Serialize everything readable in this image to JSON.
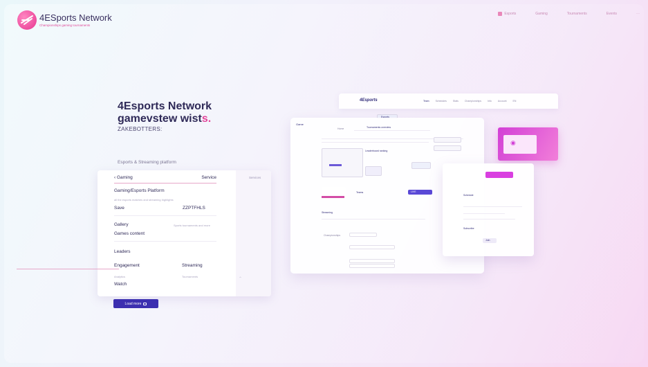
{
  "header": {
    "brand": "4ESports Network",
    "tagline": "Championships gaming tournaments",
    "nav": [
      "Esports",
      "Gaming",
      "Tournaments",
      "Events"
    ]
  },
  "hero": {
    "title_line1": "4Esports Network",
    "title_line2a": "gamevstew wist",
    "title_line2b": "s.",
    "subtitle": "ZAKEBOTTERS:",
    "platform_caption": "Esports & Streaming platform"
  },
  "card": {
    "tab_left": "Gaming",
    "tab_right": "Service",
    "tab_extra": "Services",
    "heading": "Gaming/Esports Platform",
    "desc": "all the esports matches and streaming highlights",
    "row1_left": "Save",
    "row1_right": "ZZPTFHLS",
    "row2_left": "Gallery",
    "row2_right": "Sports tournaments and more",
    "row3": "Games content",
    "row4": "Leaders",
    "row5_left": "Engagement",
    "row5_right": "Streaming",
    "row6_left": "Analytics",
    "row6_right": "Tournaments",
    "row7": "Watch"
  },
  "cta": {
    "label": "Load more"
  },
  "mock": {
    "logo": "4Esports",
    "nav": [
      "Team",
      "Schedules",
      "Stats",
      "Championships",
      "Info",
      "Account",
      "EN"
    ],
    "tab": "Esports",
    "label_side": "Game",
    "label_left": "Home",
    "section_title": "Tournaments overview",
    "list_title": "Leaderboard ranking",
    "field_a": "Teams",
    "field_b": "Streaming",
    "field_c": "Championships",
    "badge": "LIVE",
    "rp_title": "Schedule",
    "rp_field": "Subscribe",
    "rp_button": "Join"
  },
  "colors": {
    "accent": "#3c2fb0",
    "brand_pink": "#e3449a",
    "panel_pink": "#d23fd6"
  }
}
